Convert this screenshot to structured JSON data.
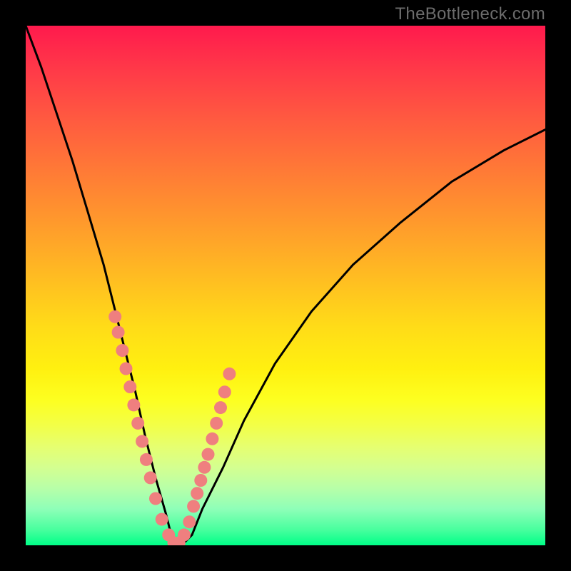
{
  "watermark": "TheBottleneck.com",
  "chart_data": {
    "type": "line",
    "title": "",
    "xlabel": "",
    "ylabel": "",
    "xlim": [
      0,
      100
    ],
    "ylim": [
      0,
      100
    ],
    "grid": false,
    "legend": false,
    "series": [
      {
        "name": "bottleneck-curve",
        "x": [
          0,
          3,
          6,
          9,
          12,
          15,
          17,
          19,
          21,
          23,
          25,
          27,
          28,
          29,
          30,
          32,
          34,
          38,
          42,
          48,
          55,
          63,
          72,
          82,
          92,
          100
        ],
        "y": [
          100,
          92,
          83,
          74,
          64,
          54,
          46,
          38,
          30,
          21,
          13,
          6,
          2,
          0,
          0,
          2,
          7,
          15,
          24,
          35,
          45,
          54,
          62,
          70,
          76,
          80
        ]
      }
    ],
    "points": [
      {
        "name": "sample-dots",
        "color": "#ef7f7f",
        "x": [
          17.2,
          17.8,
          18.6,
          19.3,
          20.1,
          20.8,
          21.6,
          22.4,
          23.2,
          24.0,
          25.0,
          26.2,
          27.5,
          28.5,
          29.5,
          30.5,
          31.5,
          32.3,
          33.0,
          33.7,
          34.4,
          35.1,
          35.9,
          36.7,
          37.5,
          38.3,
          39.2
        ],
        "y": [
          44.0,
          41.0,
          37.5,
          34.0,
          30.5,
          27.0,
          23.5,
          20.0,
          16.5,
          13.0,
          9.0,
          5.0,
          2.0,
          0.5,
          0.5,
          2.0,
          4.5,
          7.5,
          10.0,
          12.5,
          15.0,
          17.5,
          20.5,
          23.5,
          26.5,
          29.5,
          33.0
        ]
      }
    ],
    "background_gradient": {
      "type": "linear-vertical",
      "stops": [
        {
          "pos": 0.0,
          "color": "#ff1a4d"
        },
        {
          "pos": 0.5,
          "color": "#ffc020"
        },
        {
          "pos": 0.72,
          "color": "#fdff20"
        },
        {
          "pos": 1.0,
          "color": "#00ff88"
        }
      ]
    }
  }
}
